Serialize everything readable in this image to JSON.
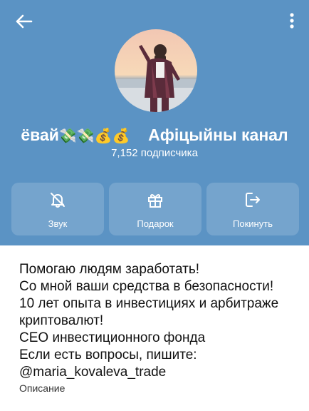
{
  "channel": {
    "title_left": "ёвай",
    "title_emoji": "💸💸💰💰",
    "title_right": "Афіцыйны канал",
    "subscribers": "7,152 подписчика"
  },
  "actions": [
    {
      "label": "Звук",
      "icon": "bell-off-icon"
    },
    {
      "label": "Подарок",
      "icon": "gift-icon"
    },
    {
      "label": "Покинуть",
      "icon": "leave-icon"
    }
  ],
  "description": {
    "lines": [
      "Помогаю людям заработать!",
      "Со мной ваши средства в безопасности!",
      "10 лет опыта в инвестициях и арбитраже",
      "криптовалют!",
      "CEO инвестиционного фонда",
      "Если есть вопросы, пишите:",
      "@maria_kovaleva_trade"
    ],
    "label": "Описание"
  },
  "colors": {
    "header": "#5b93c4",
    "action_bg": "rgba(255,255,255,0.16)",
    "text": "#111111"
  }
}
